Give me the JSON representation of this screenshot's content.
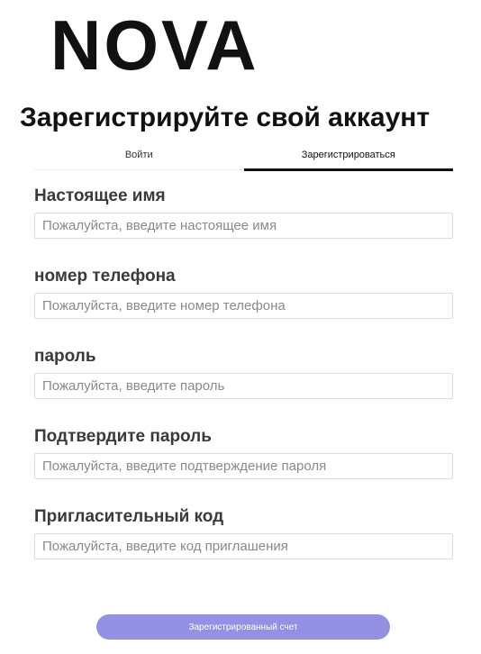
{
  "brand": {
    "logo_text": "NOVA"
  },
  "page": {
    "title": "Зарегистрируйте свой аккаунт"
  },
  "tabs": [
    {
      "label": "Войти",
      "active": false
    },
    {
      "label": "Зарегистрироваться",
      "active": true
    }
  ],
  "form": {
    "fields": [
      {
        "label": "Настоящее имя",
        "placeholder": "Пожалуйста, введите настоящее имя",
        "value": ""
      },
      {
        "label": "номер телефона",
        "placeholder": "Пожалуйста, введите номер телефона",
        "value": ""
      },
      {
        "label": "пароль",
        "placeholder": "Пожалуйста, введите пароль",
        "value": ""
      },
      {
        "label": "Подтвердите пароль",
        "placeholder": "Пожалуйста, введите подтверждение пароля",
        "value": ""
      },
      {
        "label": "Пригласительный код",
        "placeholder": "Пожалуйста, введите код приглашения",
        "value": ""
      }
    ],
    "submit_label": "Зарегистрированный счет"
  },
  "colors": {
    "submit_background": "#9490e4",
    "active_tab_underline": "#111111",
    "input_border": "#dcdcdc"
  }
}
